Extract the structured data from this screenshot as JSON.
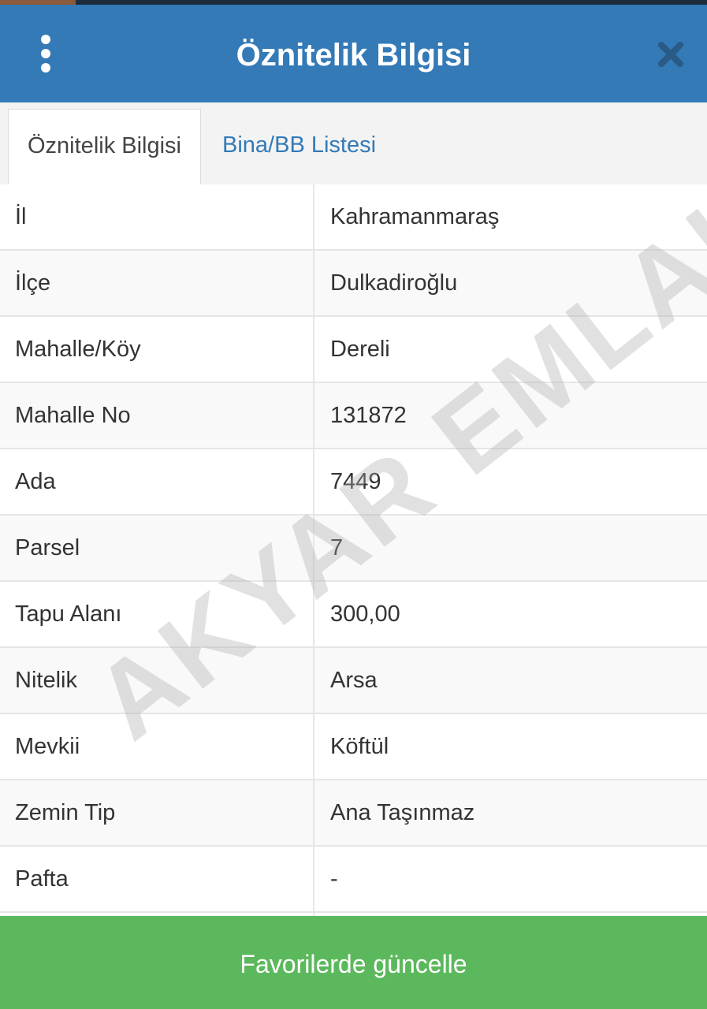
{
  "header": {
    "title": "Öznitelik Bilgisi",
    "menu_icon": "vertical-ellipsis-icon",
    "close_icon": "close-icon",
    "background": "#337ab7"
  },
  "tabs": [
    {
      "label": "Öznitelik Bilgisi",
      "active": true
    },
    {
      "label": "Bina/BB Listesi",
      "active": false
    }
  ],
  "attributes": [
    {
      "label": "İl",
      "value": "Kahramanmaraş"
    },
    {
      "label": "İlçe",
      "value": "Dulkadiroğlu"
    },
    {
      "label": "Mahalle/Köy",
      "value": "Dereli"
    },
    {
      "label": "Mahalle No",
      "value": "131872"
    },
    {
      "label": "Ada",
      "value": "7449"
    },
    {
      "label": "Parsel",
      "value": "7"
    },
    {
      "label": "Tapu Alanı",
      "value": "300,00"
    },
    {
      "label": "Nitelik",
      "value": "Arsa"
    },
    {
      "label": "Mevkii",
      "value": "Köftül"
    },
    {
      "label": "Zemin Tip",
      "value": "Ana Taşınmaz"
    },
    {
      "label": "Pafta",
      "value": "-"
    }
  ],
  "watermark": "AKYAR EMLAK",
  "footer": {
    "button_label": "Favorilerde güncelle",
    "background": "#5cb85c"
  }
}
